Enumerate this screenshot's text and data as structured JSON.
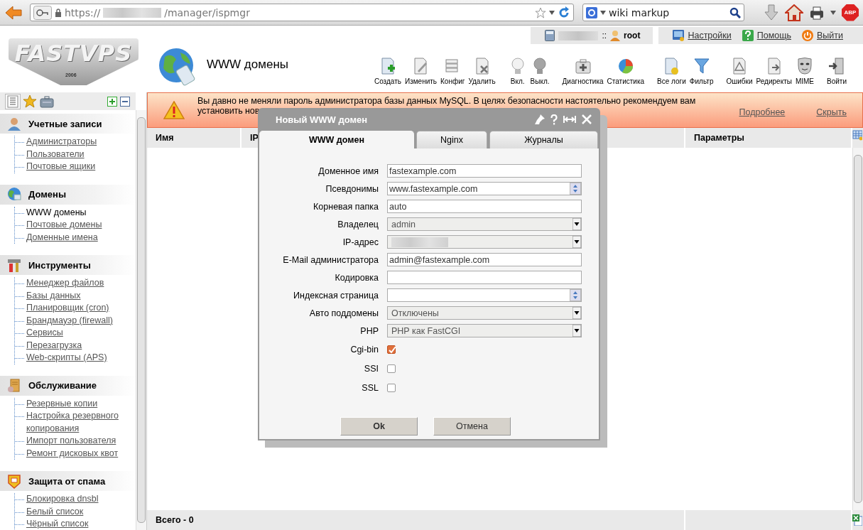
{
  "browser": {
    "url_scheme": "https://",
    "url_path": "/manager/ispmgr",
    "search": "wiki markup",
    "addon_badge": "ABP"
  },
  "header": {
    "logo": "FASTVPS",
    "logo_year": "2006",
    "page_title": "WWW домены",
    "user": {
      "separator": "::",
      "name": "root"
    },
    "links": [
      "Настройки",
      "Помощь",
      "Выйти"
    ],
    "toolbar": [
      [
        {
          "label": "Создать"
        },
        {
          "label": "Изменить"
        },
        {
          "label": "Конфиг"
        },
        {
          "label": "Удалить"
        }
      ],
      [
        {
          "label": "Вкл."
        },
        {
          "label": "Выкл."
        }
      ],
      [
        {
          "label": "Диагностика"
        },
        {
          "label": "Статистика"
        }
      ],
      [
        {
          "label": "Все логи"
        },
        {
          "label": "Фильтр"
        }
      ],
      [
        {
          "label": "Ошибки"
        },
        {
          "label": "Редиректы"
        },
        {
          "label": "MIME"
        }
      ],
      [
        {
          "label": "Войти"
        }
      ]
    ]
  },
  "sidebar": {
    "sections": [
      {
        "title": "Учетные записи",
        "items": [
          {
            "label": "Администраторы",
            "selected": false
          },
          {
            "label": "Пользователи",
            "selected": false
          },
          {
            "label": "Почтовые ящики",
            "selected": false
          }
        ]
      },
      {
        "title": "Домены",
        "items": [
          {
            "label": "WWW домены",
            "selected": true
          },
          {
            "label": "Почтовые домены",
            "selected": false
          },
          {
            "label": "Доменные имена",
            "selected": false
          }
        ]
      },
      {
        "title": "Инструменты",
        "items": [
          {
            "label": "Менеджер файлов",
            "selected": false
          },
          {
            "label": "Базы данных",
            "selected": false
          },
          {
            "label": "Планировщик (cron)",
            "selected": false
          },
          {
            "label": "Брандмауэр (firewall)",
            "selected": false
          },
          {
            "label": "Сервисы",
            "selected": false
          },
          {
            "label": "Перезагрузка",
            "selected": false
          },
          {
            "label": "Web-скрипты (APS)",
            "selected": false
          }
        ]
      },
      {
        "title": "Обслуживание",
        "items": [
          {
            "label": "Резервные копии",
            "selected": false
          },
          {
            "label": "Настройка резервного копирования",
            "selected": false
          },
          {
            "label": "Импорт пользователя",
            "selected": false
          },
          {
            "label": "Ремонт дисковых квот",
            "selected": false
          }
        ]
      },
      {
        "title": "Защита от спама",
        "items": [
          {
            "label": "Блокировка dnsbl",
            "selected": false
          },
          {
            "label": "Белый список",
            "selected": false
          },
          {
            "label": "Чёрный список",
            "selected": false
          }
        ]
      }
    ]
  },
  "banner": {
    "lines": [
      "Вы давно не меняли пароль администратора базы данных MySQL. В целях безопасности настоятельно рекомендуем вам",
      "установить нов"
    ],
    "links": [
      "Подробнее",
      "Скрыть"
    ]
  },
  "table": {
    "columns": [
      "Имя",
      "IP",
      "Параметры"
    ],
    "footer": "Всего - 0"
  },
  "dialog": {
    "title": "Новый WWW домен",
    "tabs": [
      {
        "label": "WWW домен",
        "selected": true
      },
      {
        "label": "Nginx",
        "selected": false
      },
      {
        "label": "Журналы",
        "selected": false
      }
    ],
    "fields": [
      {
        "label": "Доменное имя",
        "kind": "text",
        "value": "fastexample.com"
      },
      {
        "label": "Псевдонимы",
        "kind": "combo",
        "value": "www.fastexample.com"
      },
      {
        "label": "Корневая папка",
        "kind": "text",
        "value": "auto"
      },
      {
        "label": "Владелец",
        "kind": "select",
        "value": "admin"
      },
      {
        "label": "IP-адрес",
        "kind": "select",
        "redacted": true
      },
      {
        "label": "E-Mail администратора",
        "kind": "text",
        "value": "admin@fastexample.com"
      },
      {
        "label": "Кодировка",
        "kind": "text"
      },
      {
        "label": "Индексная страница",
        "kind": "combo"
      },
      {
        "label": "Авто поддомены",
        "kind": "select",
        "value": "Отключены"
      },
      {
        "label": "PHP",
        "kind": "select",
        "value": "PHP как FastCGI"
      },
      {
        "label": "Cgi-bin",
        "kind": "checkbox",
        "checked": true
      },
      {
        "label": "SSI",
        "kind": "checkbox",
        "checked": false
      },
      {
        "label": "SSL",
        "kind": "checkbox",
        "checked": false
      }
    ],
    "buttons": [
      "Ok",
      "Отмена"
    ]
  }
}
